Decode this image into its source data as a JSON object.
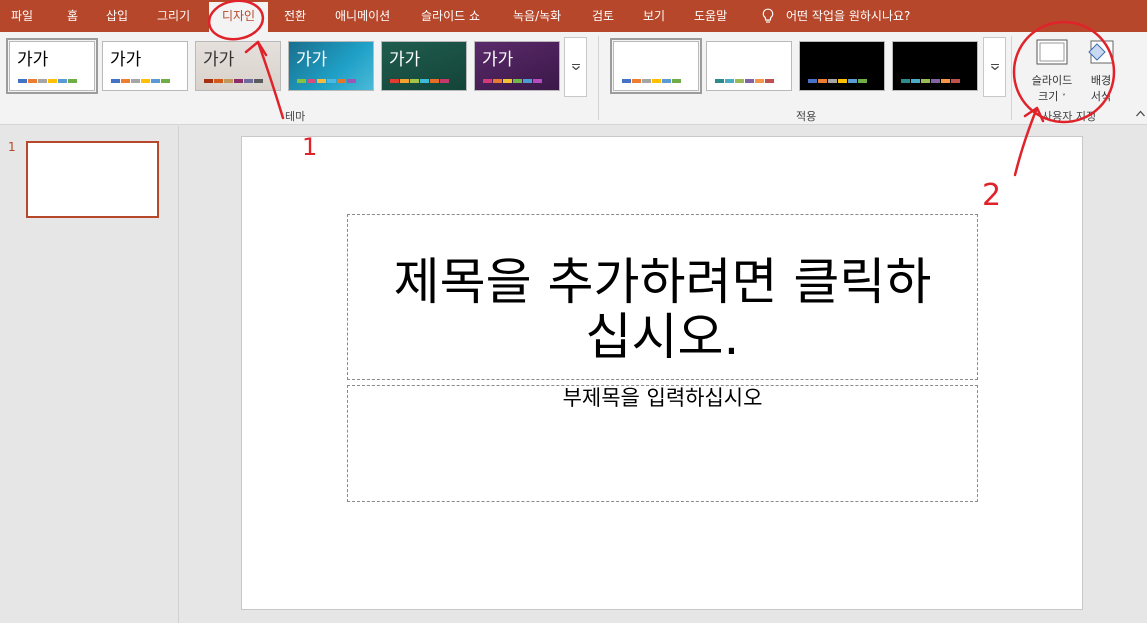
{
  "menu": {
    "file": "파일",
    "home": "홈",
    "insert": "삽입",
    "draw": "그리기",
    "design": "디자인",
    "transitions": "전환",
    "animations": "애니메이션",
    "slideshow": "슬라이드 쇼",
    "record": "녹음/녹화",
    "review": "검토",
    "view": "보기",
    "help": "도움말",
    "tell_me": "어떤 작업을 원하시나요?"
  },
  "ribbon": {
    "themes": [
      {
        "label": "가가",
        "style": "office-light"
      },
      {
        "label": "가가",
        "style": "office"
      },
      {
        "label": "가가",
        "style": "facet"
      },
      {
        "label": "가가",
        "style": "ion-teal"
      },
      {
        "label": "가가",
        "style": "ion-green"
      },
      {
        "label": "가가",
        "style": "ion-purple"
      }
    ],
    "themes_group_label": "테마",
    "variants_group_label": "적용",
    "customize": {
      "slide_size_line1": "슬라이드",
      "slide_size_line2": "크기",
      "format_bg_line1": "배경",
      "format_bg_line2": "서식",
      "group_label": "사용자 지정"
    }
  },
  "slides": {
    "current_number": "1"
  },
  "slide": {
    "title_line1": "제목을 추가하려면 클릭하",
    "title_line2": "십시오.",
    "subtitle": "부제목을 입력하십시오"
  },
  "annotations": {
    "mark_1": "1",
    "mark_2": "2"
  },
  "colors": {
    "accent": "#b7472a",
    "annotation": "#e0222a"
  }
}
